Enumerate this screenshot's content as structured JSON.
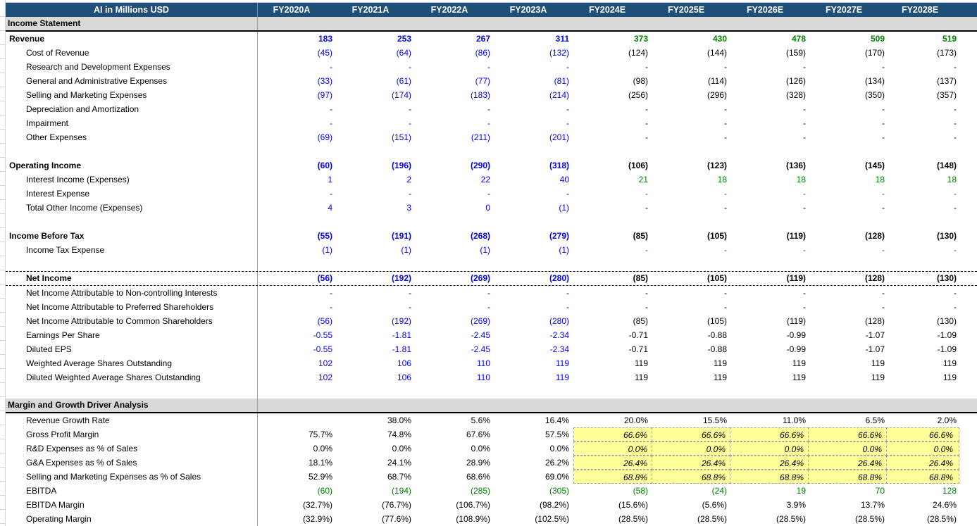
{
  "header": {
    "title": "AI in Millions USD",
    "years": [
      "FY2020A",
      "FY2021A",
      "FY2022A",
      "FY2023A",
      "FY2024E",
      "FY2025E",
      "FY2026E",
      "FY2027E",
      "FY2028E"
    ]
  },
  "colors": {
    "header_bg": "#1f4e79",
    "section_bg": "#d9d9d9",
    "historical_input": "#0000ff",
    "forecast_link": "#008000",
    "assumption_fill": "#ffff99"
  },
  "income_statement": {
    "section_title": "Income Statement",
    "rows": [
      {
        "label": "Revenue",
        "bold": true,
        "indent": 0,
        "values": [
          "183",
          "253",
          "267",
          "311",
          "373",
          "430",
          "478",
          "509",
          "519"
        ],
        "colors": [
          "blue",
          "blue",
          "blue",
          "blue",
          "green",
          "green",
          "green",
          "green",
          "green"
        ]
      },
      {
        "label": "Cost of Revenue",
        "indent": 1,
        "values": [
          "(45)",
          "(64)",
          "(86)",
          "(132)",
          "(124)",
          "(144)",
          "(159)",
          "(170)",
          "(173)"
        ],
        "colors": [
          "blue",
          "blue",
          "blue",
          "blue",
          "black",
          "black",
          "black",
          "black",
          "black"
        ]
      },
      {
        "label": "Research and Development Expenses",
        "indent": 1,
        "values": [
          "-",
          "-",
          "-",
          "-",
          "-",
          "-",
          "-",
          "-",
          "-"
        ],
        "colors": [
          "blue",
          "blue",
          "blue",
          "blue",
          "black",
          "black",
          "black",
          "black",
          "black"
        ]
      },
      {
        "label": "General and Administrative Expenses",
        "indent": 1,
        "values": [
          "(33)",
          "(61)",
          "(77)",
          "(81)",
          "(98)",
          "(114)",
          "(126)",
          "(134)",
          "(137)"
        ],
        "colors": [
          "blue",
          "blue",
          "blue",
          "blue",
          "black",
          "black",
          "black",
          "black",
          "black"
        ]
      },
      {
        "label": "Selling and Marketing Expenses",
        "indent": 1,
        "values": [
          "(97)",
          "(174)",
          "(183)",
          "(214)",
          "(256)",
          "(296)",
          "(328)",
          "(350)",
          "(357)"
        ],
        "colors": [
          "blue",
          "blue",
          "blue",
          "blue",
          "black",
          "black",
          "black",
          "black",
          "black"
        ]
      },
      {
        "label": "Depreciation and Amortization",
        "indent": 1,
        "values": [
          "-",
          "-",
          "-",
          "-",
          "-",
          "-",
          "-",
          "-",
          "-"
        ],
        "colors": [
          "blue",
          "blue",
          "blue",
          "blue",
          "black",
          "black",
          "black",
          "black",
          "black"
        ]
      },
      {
        "label": "Impairment",
        "indent": 1,
        "values": [
          "-",
          "-",
          "-",
          "-",
          "-",
          "-",
          "-",
          "-",
          "-"
        ],
        "colors": [
          "blue",
          "blue",
          "blue",
          "blue",
          "black",
          "black",
          "black",
          "black",
          "black"
        ]
      },
      {
        "label": "Other Expenses",
        "indent": 1,
        "values": [
          "(69)",
          "(151)",
          "(211)",
          "(201)",
          "-",
          "-",
          "-",
          "-",
          "-"
        ],
        "colors": [
          "blue",
          "blue",
          "blue",
          "blue",
          "black",
          "black",
          "black",
          "black",
          "black"
        ]
      },
      {
        "blank": true
      },
      {
        "label": "Operating Income",
        "bold": true,
        "indent": 0,
        "values": [
          "(60)",
          "(196)",
          "(290)",
          "(318)",
          "(106)",
          "(123)",
          "(136)",
          "(145)",
          "(148)"
        ],
        "colors": [
          "blue",
          "blue",
          "blue",
          "blue",
          "black",
          "black",
          "black",
          "black",
          "black"
        ]
      },
      {
        "label": "Interest Income (Expenses)",
        "indent": 1,
        "values": [
          "1",
          "2",
          "22",
          "40",
          "21",
          "18",
          "18",
          "18",
          "18"
        ],
        "colors": [
          "blue",
          "blue",
          "blue",
          "blue",
          "green",
          "green",
          "green",
          "green",
          "green"
        ]
      },
      {
        "label": "Interest Expense",
        "indent": 1,
        "values": [
          "-",
          "-",
          "-",
          "-",
          "-",
          "-",
          "-",
          "-",
          "-"
        ],
        "colors": [
          "blue",
          "blue",
          "blue",
          "blue",
          "green",
          "green",
          "green",
          "green",
          "green"
        ]
      },
      {
        "label": "Total Other Income (Expenses)",
        "indent": 1,
        "values": [
          "4",
          "3",
          "0",
          "(1)",
          "-",
          "-",
          "-",
          "-",
          "-"
        ],
        "colors": [
          "blue",
          "blue",
          "blue",
          "blue",
          "black",
          "black",
          "black",
          "black",
          "black"
        ]
      },
      {
        "blank": true
      },
      {
        "label": "Income Before Tax",
        "bold": true,
        "indent": 0,
        "values": [
          "(55)",
          "(191)",
          "(268)",
          "(279)",
          "(85)",
          "(105)",
          "(119)",
          "(128)",
          "(130)"
        ],
        "colors": [
          "blue",
          "blue",
          "blue",
          "blue",
          "black",
          "black",
          "black",
          "black",
          "black"
        ]
      },
      {
        "label": "Income Tax Expense",
        "indent": 1,
        "values": [
          "(1)",
          "(1)",
          "(1)",
          "(1)",
          "-",
          "-",
          "-",
          "-",
          "-"
        ],
        "colors": [
          "blue",
          "blue",
          "blue",
          "blue",
          "green",
          "green",
          "green",
          "green",
          "green"
        ]
      },
      {
        "blank": true
      },
      {
        "label": "Net Income",
        "bold": true,
        "indent": 1,
        "dashed": true,
        "values": [
          "(56)",
          "(192)",
          "(269)",
          "(280)",
          "(85)",
          "(105)",
          "(119)",
          "(128)",
          "(130)"
        ],
        "colors": [
          "blue",
          "blue",
          "blue",
          "blue",
          "black",
          "black",
          "black",
          "black",
          "black"
        ]
      },
      {
        "label": "Net Income Attributable to Non-controlling Interests",
        "indent": 1,
        "values": [
          "-",
          "-",
          "-",
          "-",
          "-",
          "-",
          "-",
          "-",
          "-"
        ],
        "colors": [
          "blue",
          "blue",
          "blue",
          "blue",
          "black",
          "black",
          "black",
          "black",
          "black"
        ]
      },
      {
        "label": "Net Income Attributable to Preferred Shareholders",
        "indent": 1,
        "values": [
          "-",
          "-",
          "-",
          "-",
          "-",
          "-",
          "-",
          "-",
          "-"
        ],
        "colors": [
          "blue",
          "blue",
          "blue",
          "blue",
          "black",
          "black",
          "black",
          "black",
          "black"
        ]
      },
      {
        "label": "Net Income Attributable to Common Shareholders",
        "indent": 1,
        "values": [
          "(56)",
          "(192)",
          "(269)",
          "(280)",
          "(85)",
          "(105)",
          "(119)",
          "(128)",
          "(130)"
        ],
        "colors": [
          "blue",
          "blue",
          "blue",
          "blue",
          "black",
          "black",
          "black",
          "black",
          "black"
        ]
      },
      {
        "label": "Earnings Per Share",
        "indent": 1,
        "values": [
          "-0.55",
          "-1.81",
          "-2.45",
          "-2.34",
          "-0.71",
          "-0.88",
          "-0.99",
          "-1.07",
          "-1.09"
        ],
        "colors": [
          "blue",
          "blue",
          "blue",
          "blue",
          "black",
          "black",
          "black",
          "black",
          "black"
        ]
      },
      {
        "label": "Diluted EPS",
        "indent": 1,
        "values": [
          "-0.55",
          "-1.81",
          "-2.45",
          "-2.34",
          "-0.71",
          "-0.88",
          "-0.99",
          "-1.07",
          "-1.09"
        ],
        "colors": [
          "blue",
          "blue",
          "blue",
          "blue",
          "black",
          "black",
          "black",
          "black",
          "black"
        ]
      },
      {
        "label": "Weighted Average Shares Outstanding",
        "indent": 1,
        "values": [
          "102",
          "106",
          "110",
          "119",
          "119",
          "119",
          "119",
          "119",
          "119"
        ],
        "colors": [
          "blue",
          "blue",
          "blue",
          "blue",
          "black",
          "black",
          "black",
          "black",
          "black"
        ]
      },
      {
        "label": "Diluted Weighted Average Shares Outstanding",
        "indent": 1,
        "values": [
          "102",
          "106",
          "110",
          "119",
          "119",
          "119",
          "119",
          "119",
          "119"
        ],
        "colors": [
          "blue",
          "blue",
          "blue",
          "blue",
          "black",
          "black",
          "black",
          "black",
          "black"
        ]
      },
      {
        "blank": true
      }
    ]
  },
  "margin_analysis": {
    "section_title": "Margin and Growth Driver Analysis",
    "rows": [
      {
        "label": "Revenue Growth Rate",
        "indent": 1,
        "values": [
          "",
          "38.0%",
          "5.6%",
          "16.4%",
          "20.0%",
          "15.5%",
          "11.0%",
          "6.5%",
          "2.0%"
        ],
        "colors": [
          "black",
          "black",
          "black",
          "black",
          "black",
          "black",
          "black",
          "black",
          "black"
        ]
      },
      {
        "label": "Gross Profit Margin",
        "indent": 1,
        "assumption": true,
        "values": [
          "75.7%",
          "74.8%",
          "67.6%",
          "57.5%",
          "66.6%",
          "66.6%",
          "66.6%",
          "66.6%",
          "66.6%"
        ],
        "colors": [
          "black",
          "black",
          "black",
          "black",
          "black",
          "black",
          "black",
          "black",
          "black"
        ]
      },
      {
        "label": "R&D Expenses as % of Sales",
        "indent": 1,
        "assumption": true,
        "values": [
          "0.0%",
          "0.0%",
          "0.0%",
          "0.0%",
          "0.0%",
          "0.0%",
          "0.0%",
          "0.0%",
          "0.0%"
        ],
        "colors": [
          "black",
          "black",
          "black",
          "black",
          "black",
          "black",
          "black",
          "black",
          "black"
        ]
      },
      {
        "label": "G&A Expenses as % of Sales",
        "indent": 1,
        "assumption": true,
        "values": [
          "18.1%",
          "24.1%",
          "28.9%",
          "26.2%",
          "26.4%",
          "26.4%",
          "26.4%",
          "26.4%",
          "26.4%"
        ],
        "colors": [
          "black",
          "black",
          "black",
          "black",
          "black",
          "black",
          "black",
          "black",
          "black"
        ]
      },
      {
        "label": "Selling and Marketing Expenses as % of Sales",
        "indent": 1,
        "assumption": true,
        "values": [
          "52.9%",
          "68.7%",
          "68.6%",
          "69.0%",
          "68.8%",
          "68.8%",
          "68.8%",
          "68.8%",
          "68.8%"
        ],
        "colors": [
          "black",
          "black",
          "black",
          "black",
          "black",
          "black",
          "black",
          "black",
          "black"
        ]
      },
      {
        "label": "EBITDA",
        "indent": 1,
        "values": [
          "(60)",
          "(194)",
          "(285)",
          "(305)",
          "(58)",
          "(24)",
          "19",
          "70",
          "128"
        ],
        "colors": [
          "green",
          "green",
          "green",
          "green",
          "green",
          "green",
          "green",
          "green",
          "green"
        ]
      },
      {
        "label": "EBITDA Margin",
        "indent": 1,
        "values": [
          "(32.7%)",
          "(76.7%)",
          "(106.7%)",
          "(98.2%)",
          "(15.6%)",
          "(5.6%)",
          "3.9%",
          "13.7%",
          "24.6%"
        ],
        "colors": [
          "black",
          "black",
          "black",
          "black",
          "black",
          "black",
          "black",
          "black",
          "black"
        ]
      },
      {
        "label": "Operating Margin",
        "indent": 1,
        "values": [
          "(32.9%)",
          "(77.6%)",
          "(108.9%)",
          "(102.5%)",
          "(28.5%)",
          "(28.5%)",
          "(28.5%)",
          "(28.5%)",
          "(28.5%)"
        ],
        "colors": [
          "black",
          "black",
          "black",
          "black",
          "black",
          "black",
          "black",
          "black",
          "black"
        ]
      }
    ]
  }
}
